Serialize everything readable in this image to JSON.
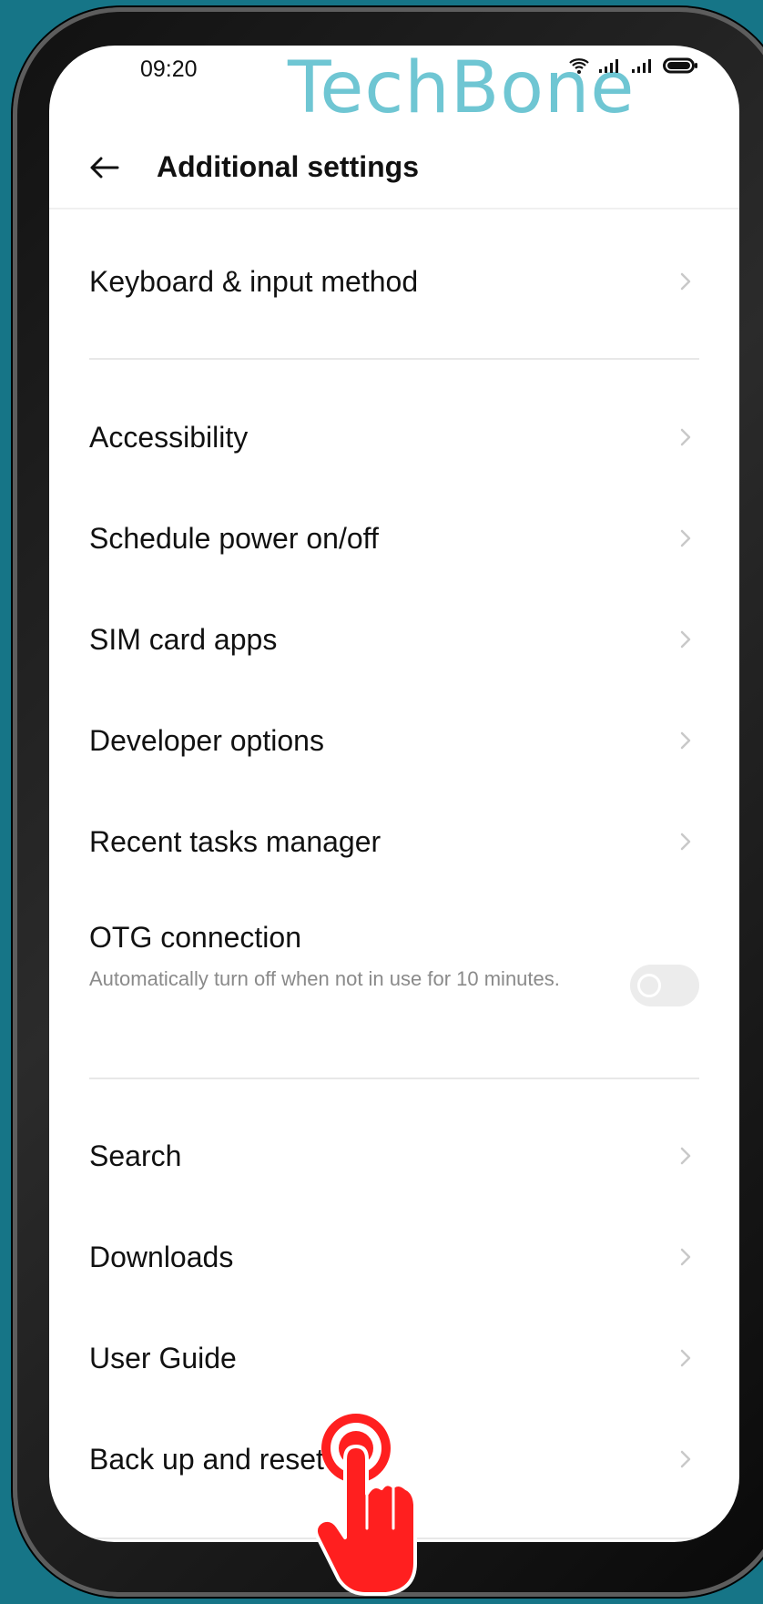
{
  "status": {
    "time": "09:20",
    "watermark": "TechBone",
    "icons": [
      "wifi-icon",
      "signal-icon",
      "signal-icon",
      "battery-icon"
    ]
  },
  "header": {
    "back_icon": "arrow-left-icon",
    "title": "Additional settings"
  },
  "items": [
    {
      "label": "Keyboard & input method",
      "chevron": true
    },
    {
      "label": "Accessibility",
      "chevron": true
    },
    {
      "label": "Schedule power on/off",
      "chevron": true
    },
    {
      "label": "SIM card apps",
      "chevron": true
    },
    {
      "label": "Developer options",
      "chevron": true
    },
    {
      "label": "Recent tasks manager",
      "chevron": true
    },
    {
      "label": "OTG connection",
      "description": "Automatically turn off when not in use for 10 minutes.",
      "toggle": false
    },
    {
      "label": "Search",
      "chevron": true
    },
    {
      "label": "Downloads",
      "chevron": true
    },
    {
      "label": "User Guide",
      "chevron": true
    },
    {
      "label": "Back up and reset",
      "chevron": true
    }
  ],
  "colors": {
    "background": "#167587",
    "watermark": "#6fc6d3",
    "text": "#111111",
    "muted_text": "#8a8a8a",
    "chevron": "#c9c9c9",
    "divider": "#e8e8e8",
    "tap_indicator": "#ff1f1f"
  }
}
